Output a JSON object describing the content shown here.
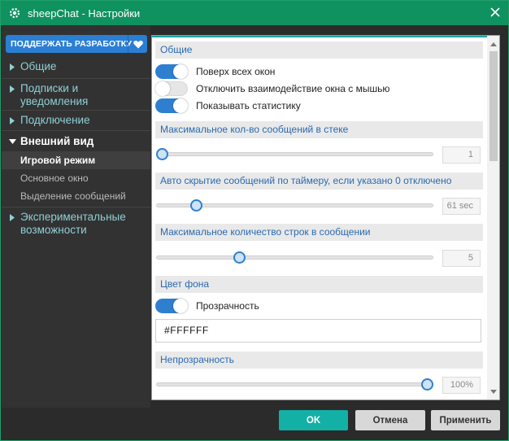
{
  "window": {
    "title": "sheepChat - Настройки"
  },
  "sidebar": {
    "support_label": "ПОДДЕРЖАТЬ РАЗРАБОТКУ",
    "nav": [
      {
        "label": "Общие"
      },
      {
        "label_line1": "Подписки и",
        "label_line2": "уведомления"
      },
      {
        "label": "Подключение"
      },
      {
        "label": "Внешний вид"
      },
      {
        "label_line1": "Экспериментальные",
        "label_line2": "возможности"
      }
    ],
    "subitems": [
      "Игровой режим",
      "Основное окно",
      "Выделение сообщений"
    ]
  },
  "main": {
    "general": {
      "header": "Общие",
      "toggles": [
        {
          "label": "Поверх всех окон",
          "on": true
        },
        {
          "label": "Отключить взаимодействие окна с мышью",
          "on": false
        },
        {
          "label": "Показывать статистику",
          "on": true
        }
      ]
    },
    "max_messages": {
      "header": "Максимальное кол-во сообщений в стеке",
      "value": "1",
      "fraction": 0.0
    },
    "auto_hide": {
      "header": "Авто скрытие сообщений по таймеру, если указано 0 отключено",
      "value": "61 sec",
      "fraction": 0.13
    },
    "max_lines": {
      "header": "Максимальное количество строк в сообщении",
      "value": "5",
      "fraction": 0.29
    },
    "background": {
      "header": "Цвет фона",
      "toggle_label": "Прозрачность",
      "toggle_on": true,
      "color_value": "#FFFFFF"
    },
    "opacity": {
      "header": "Непрозрачность",
      "value": "100%",
      "fraction": 1.0
    }
  },
  "footer": {
    "ok": "OK",
    "cancel": "Отмена",
    "apply": "Применить"
  },
  "colors": {
    "titlebar": "#0f9160",
    "accent": "#2e7fd0",
    "ok_button": "#13b0a6",
    "nav_text": "#8fd0d6"
  }
}
